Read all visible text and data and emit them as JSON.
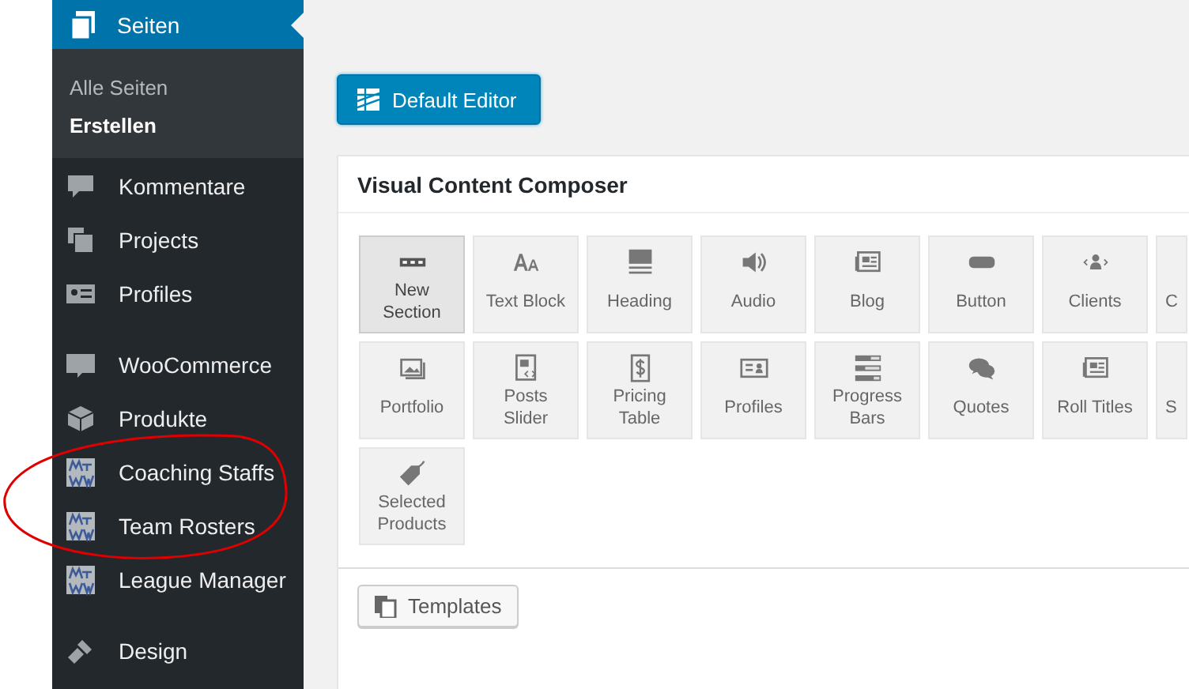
{
  "sidebar": {
    "groups": [
      [
        {
          "label": "Seiten",
          "selected": true,
          "children": [
            {
              "label": "Alle Seiten",
              "selected": false
            },
            {
              "label": "Erstellen",
              "selected": true
            }
          ]
        }
      ],
      [
        {
          "label": "Kommentare",
          "selected": false
        },
        {
          "label": "Projects",
          "selected": false
        },
        {
          "label": "Profiles",
          "selected": false
        }
      ],
      [
        {
          "label": "WooCommerce",
          "selected": false
        },
        {
          "label": "Produkte",
          "selected": false
        },
        {
          "label": "Coaching Staffs",
          "selected": false
        },
        {
          "label": "Team Rosters",
          "selected": false
        },
        {
          "label": "League Manager",
          "selected": false
        }
      ],
      [
        {
          "label": "Design",
          "selected": false
        }
      ]
    ]
  },
  "default_editor_button": "Default Editor",
  "composer": {
    "title": "Visual Content Composer",
    "rows": [
      [
        {
          "label": "New Section",
          "selected": true
        },
        {
          "label": "Text Block",
          "selected": false
        },
        {
          "label": "Heading",
          "selected": false
        },
        {
          "label": "Audio",
          "selected": false
        },
        {
          "label": "Blog",
          "selected": false
        },
        {
          "label": "Button",
          "selected": false
        },
        {
          "label": "Clients",
          "selected": false
        },
        {
          "label": "C",
          "selected": false
        }
      ],
      [
        {
          "label": "Portfolio",
          "selected": false
        },
        {
          "label": "Posts Slider",
          "selected": false
        },
        {
          "label": "Pricing Table",
          "selected": false
        },
        {
          "label": "Profiles",
          "selected": false
        },
        {
          "label": "Progress Bars",
          "selected": false
        },
        {
          "label": "Quotes",
          "selected": false
        },
        {
          "label": "Roll Titles",
          "selected": false
        },
        {
          "label": "S",
          "selected": false
        }
      ],
      [
        {
          "label": "Selected Products",
          "selected": false
        }
      ]
    ],
    "templates_button": "Templates"
  },
  "annotation": {
    "kind": "ellipse"
  }
}
